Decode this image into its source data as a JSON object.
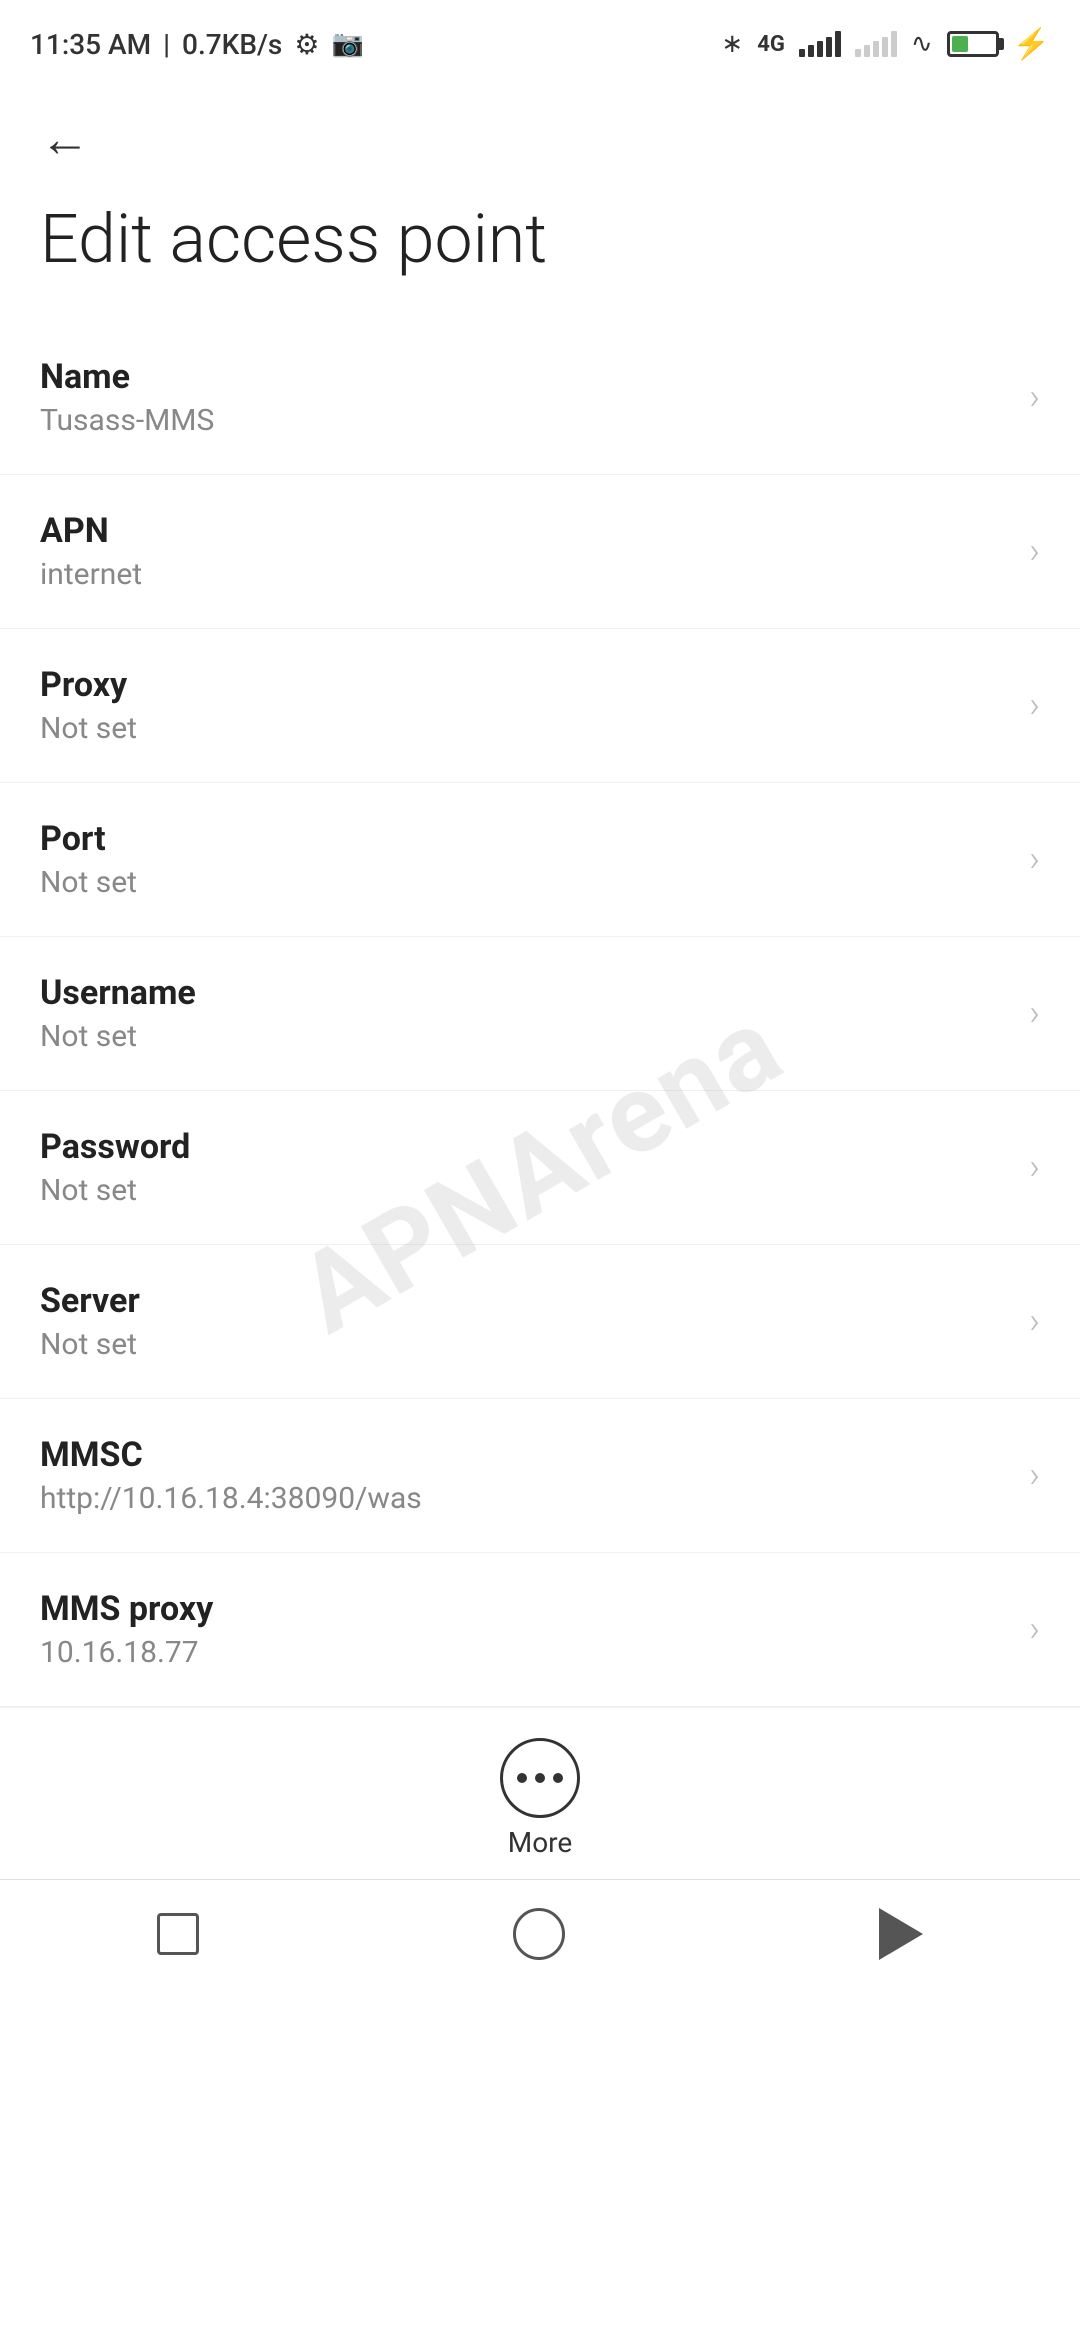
{
  "statusBar": {
    "time": "11:35 AM",
    "network": "0.7KB/s",
    "batteryPercent": "38"
  },
  "header": {
    "backLabel": "←",
    "title": "Edit access point"
  },
  "settings": [
    {
      "label": "Name",
      "value": "Tusass-MMS"
    },
    {
      "label": "APN",
      "value": "internet"
    },
    {
      "label": "Proxy",
      "value": "Not set"
    },
    {
      "label": "Port",
      "value": "Not set"
    },
    {
      "label": "Username",
      "value": "Not set"
    },
    {
      "label": "Password",
      "value": "Not set"
    },
    {
      "label": "Server",
      "value": "Not set"
    },
    {
      "label": "MMSC",
      "value": "http://10.16.18.4:38090/was"
    },
    {
      "label": "MMS proxy",
      "value": "10.16.18.77"
    }
  ],
  "more": {
    "label": "More"
  },
  "watermark": {
    "line1": "APNArena"
  }
}
